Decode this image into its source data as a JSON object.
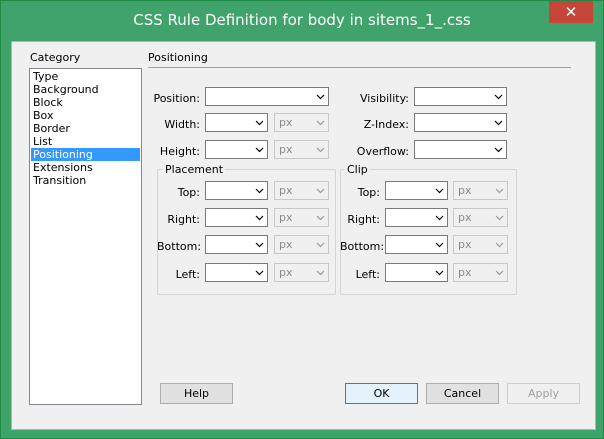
{
  "window": {
    "title": "CSS Rule Definition for body in sitems_1_.css",
    "close_label": "✕"
  },
  "category": {
    "label": "Category",
    "items": [
      "Type",
      "Background",
      "Block",
      "Box",
      "Border",
      "List",
      "Positioning",
      "Extensions",
      "Transition"
    ],
    "selected": "Positioning"
  },
  "panel": {
    "title": "Positioning",
    "position_label": "Position:",
    "width_label": "Width:",
    "height_label": "Height:",
    "visibility_label": "Visibility:",
    "zindex_label": "Z-Index:",
    "overflow_label": "Overflow:",
    "unit_px": "px",
    "placement": {
      "label": "Placement",
      "top": "Top:",
      "right": "Right:",
      "bottom": "Bottom:",
      "left": "Left:"
    },
    "clip": {
      "label": "Clip",
      "top": "Top:",
      "right": "Right:",
      "bottom": "Bottom:",
      "left": "Left:"
    }
  },
  "buttons": {
    "help": "Help",
    "ok": "OK",
    "cancel": "Cancel",
    "apply": "Apply"
  },
  "colors": {
    "titlebar": "#3fa36b",
    "selection": "#3399ff",
    "close": "#c7463a"
  }
}
